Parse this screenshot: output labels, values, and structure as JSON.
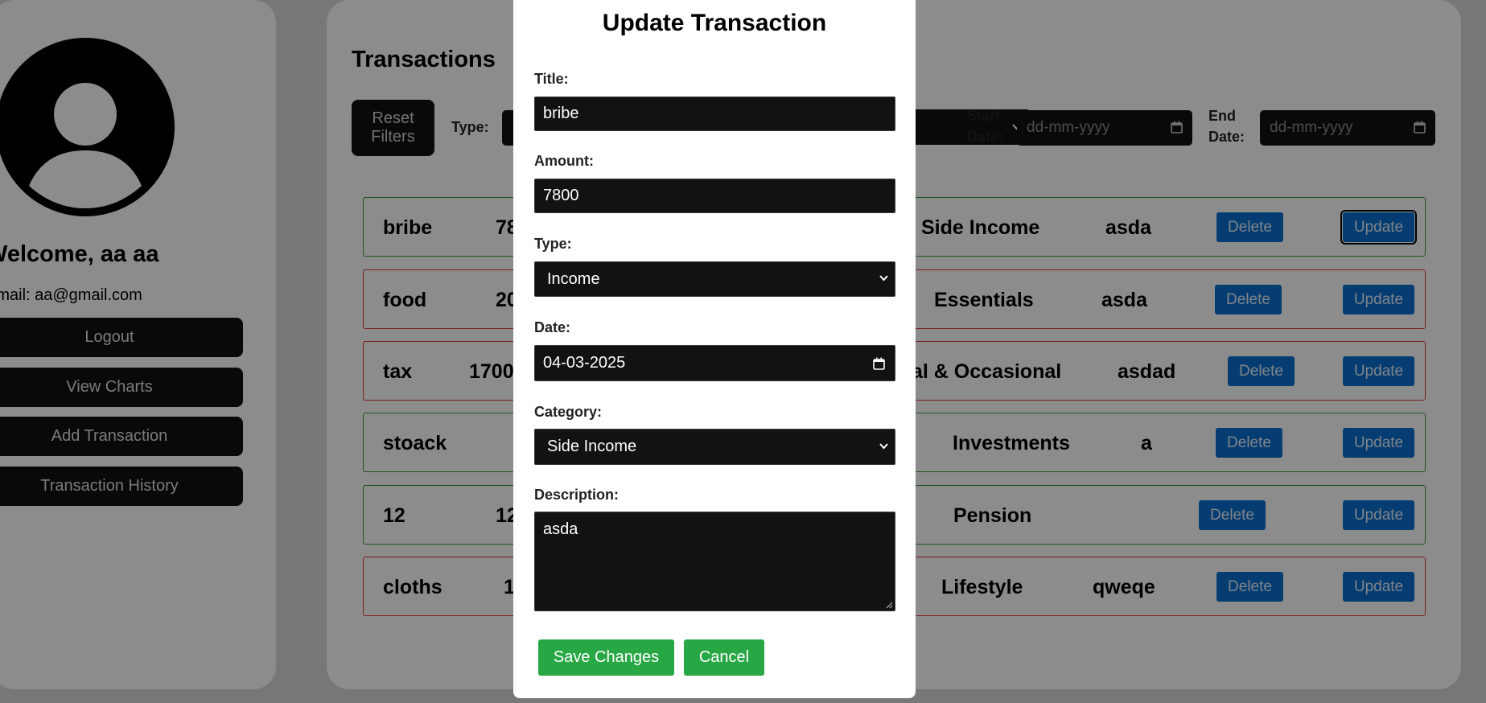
{
  "sidebar": {
    "welcome": "Welcome, aa aa",
    "email": "Email: aa@gmail.com",
    "buttons": [
      "Logout",
      "View Charts",
      "Add Transaction",
      "Transaction History"
    ]
  },
  "main": {
    "title": "Transactions",
    "reset_filters": "Reset Filters",
    "type_label": "Type:",
    "start_date_label": "Start Date:",
    "end_date_label": "End Date:",
    "date_placeholder": "dd-mm-yyyy"
  },
  "transactions": [
    {
      "title": "bribe",
      "amount_visible": "78",
      "category": "Side Income",
      "description": "asda",
      "kind": "income"
    },
    {
      "title": "food",
      "amount_visible": "20",
      "category": "Essentials",
      "description": "asda",
      "kind": "expense"
    },
    {
      "title": "tax",
      "amount_visible": "1700",
      "category": "al & Occasional",
      "description": "asdad",
      "kind": "expense"
    },
    {
      "title": "stoack",
      "amount_visible": "",
      "category": "Investments",
      "description": "a",
      "kind": "income"
    },
    {
      "title": "12",
      "amount_visible": "12",
      "category": "Pension",
      "description": "",
      "kind": "income"
    },
    {
      "title": "cloths",
      "amount_visible": "1",
      "category": "Lifestyle",
      "description": "qweqe",
      "kind": "expense"
    }
  ],
  "row_buttons": {
    "delete": "Delete",
    "update": "Update"
  },
  "modal": {
    "title": "Update Transaction",
    "title_label": "Title:",
    "title_value": "bribe",
    "amount_label": "Amount:",
    "amount_value": "7800",
    "type_label": "Type:",
    "type_value": "Income",
    "date_label": "Date:",
    "date_value": "04-03-2025",
    "category_label": "Category:",
    "category_value": "Side Income",
    "description_label": "Description:",
    "description_value": "asda",
    "save_button": "Save Changes",
    "cancel_button": "Cancel"
  },
  "colors": {
    "income_border": "#3a9a3a",
    "expense_border": "#e03a3a",
    "primary_button": "#0a6fd1",
    "success_button": "#28a745",
    "dark_field": "#121212"
  }
}
